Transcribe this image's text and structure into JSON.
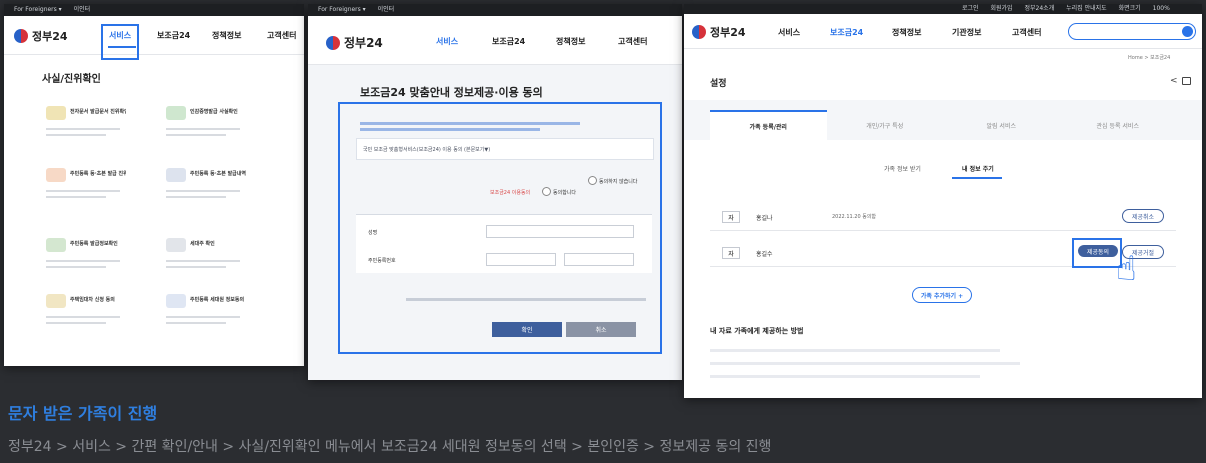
{
  "screen1": {
    "topbar": [
      "For Foreigners ▾",
      "이인터"
    ],
    "brand": "정부24",
    "nav": [
      "서비스",
      "보조금24",
      "정책정보",
      "고객센터"
    ],
    "section_title": "사실/진위확인",
    "cards": [
      "전자문서 발급문서 진위확인",
      "인감증명발급 사실확인",
      "주민등록 등·초본 발급 진위확인",
      "주민등록 등·초본 발급내역 확인",
      "주민등록 발급정보확인",
      "세대주 확인",
      "주택임대차 신청 동의",
      "주민등록 세대원 정보동의"
    ]
  },
  "screen2": {
    "topbar": [
      "For Foreigners ▾",
      "이인터"
    ],
    "brand": "정부24",
    "nav": [
      "서비스",
      "보조금24",
      "정책정보",
      "고객센터"
    ],
    "page_title": "보조금24 맞춤안내 정보제공·이용 동의",
    "section_label": "국민 보조금 맞춤형서비스(보조금24) 이용 동의 (본문보기▼)",
    "consent_label": "보조금24 이용동의",
    "agree": "동의합니다",
    "disagree": "동의하지 않습니다",
    "field_name": "성명",
    "field_rrn": "주민등록번호",
    "confirm": "확인",
    "cancel": "취소"
  },
  "screen3": {
    "top_links": [
      "로그인",
      "회원가입",
      "정부24소개",
      "누리집 안내지도",
      "화면크기",
      "100%"
    ],
    "brand": "정부24",
    "nav": [
      "서비스",
      "보조금24",
      "정책정보",
      "기관정보",
      "고객센터"
    ],
    "breadcrumb": "Home > 보조금24",
    "page_title": "설정",
    "tabs": [
      "가족 등록/관리",
      "개인/가구 특성",
      "알림 서비스",
      "관심 등록 서비스"
    ],
    "subtabs": [
      "가족 정보 받기",
      "내 정보 주기"
    ],
    "rows": [
      {
        "rel": "자",
        "name": "홍길나",
        "date": "2022.11.20 동의함",
        "actions": [
          "제공취소"
        ]
      },
      {
        "rel": "자",
        "name": "홍길수",
        "date": "",
        "actions": [
          "제공동의",
          "제공거절"
        ]
      }
    ],
    "add_button": "가족 추가하기 +",
    "guide_title": "내 자료 가족에게 제공하는 방법"
  },
  "caption": {
    "title": "문자 받은 가족이 진행",
    "description": "정부24 > 서비스 > 간편 확인/안내 > 사실/진위확인 메뉴에서 보조금24 세대원 정보동의 선택 > 본인인증 > 정보제공 동의 진행"
  },
  "colors": {
    "accent": "#2a73e8",
    "caption_title": "#2f7fe0",
    "dark_button": "#3e5f9d"
  }
}
